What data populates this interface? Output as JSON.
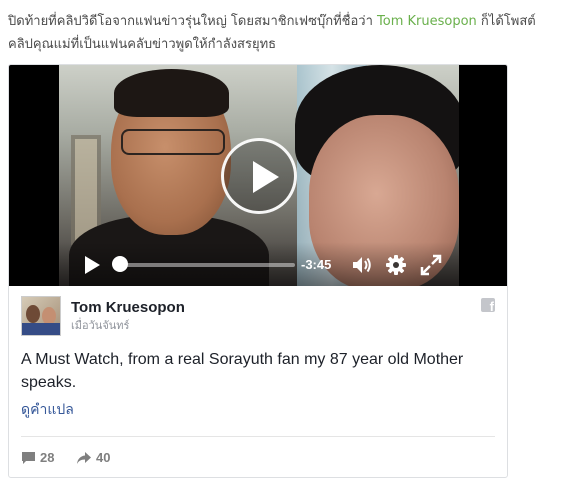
{
  "intro": {
    "text_before": "ปิดท้ายที่คลิปวิดีโอจากแฟนข่าวรุ่นใหญ่ โดยสมาชิกเฟซบุ๊กที่ชื่อว่า ",
    "author_link": "Tom Kruesopon",
    "text_after": " ก็ได้โพสต์คลิปคุณแม่ที่เป็นแฟนคลับข่าวพูดให้กำลังสรยุทธ"
  },
  "video": {
    "time_remaining": "-3:45",
    "progress_fraction": 0.05,
    "icons": {
      "play": "play-icon",
      "volume": "volume-icon",
      "settings": "gear-icon",
      "fullscreen": "fullscreen-icon"
    }
  },
  "post": {
    "author": "Tom Kruesopon",
    "time": "เมื่อวันจันทร์",
    "text": "A Must Watch, from a real Sorayuth fan my 87 year old Mother speaks.",
    "see_translation": "ดูคำแปล",
    "comments_count": "28",
    "shares_count": "40",
    "logo_glyph": "f"
  },
  "colors": {
    "link_green": "#6ab04c",
    "fb_link_blue": "#365899",
    "border": "#dddfe2"
  }
}
